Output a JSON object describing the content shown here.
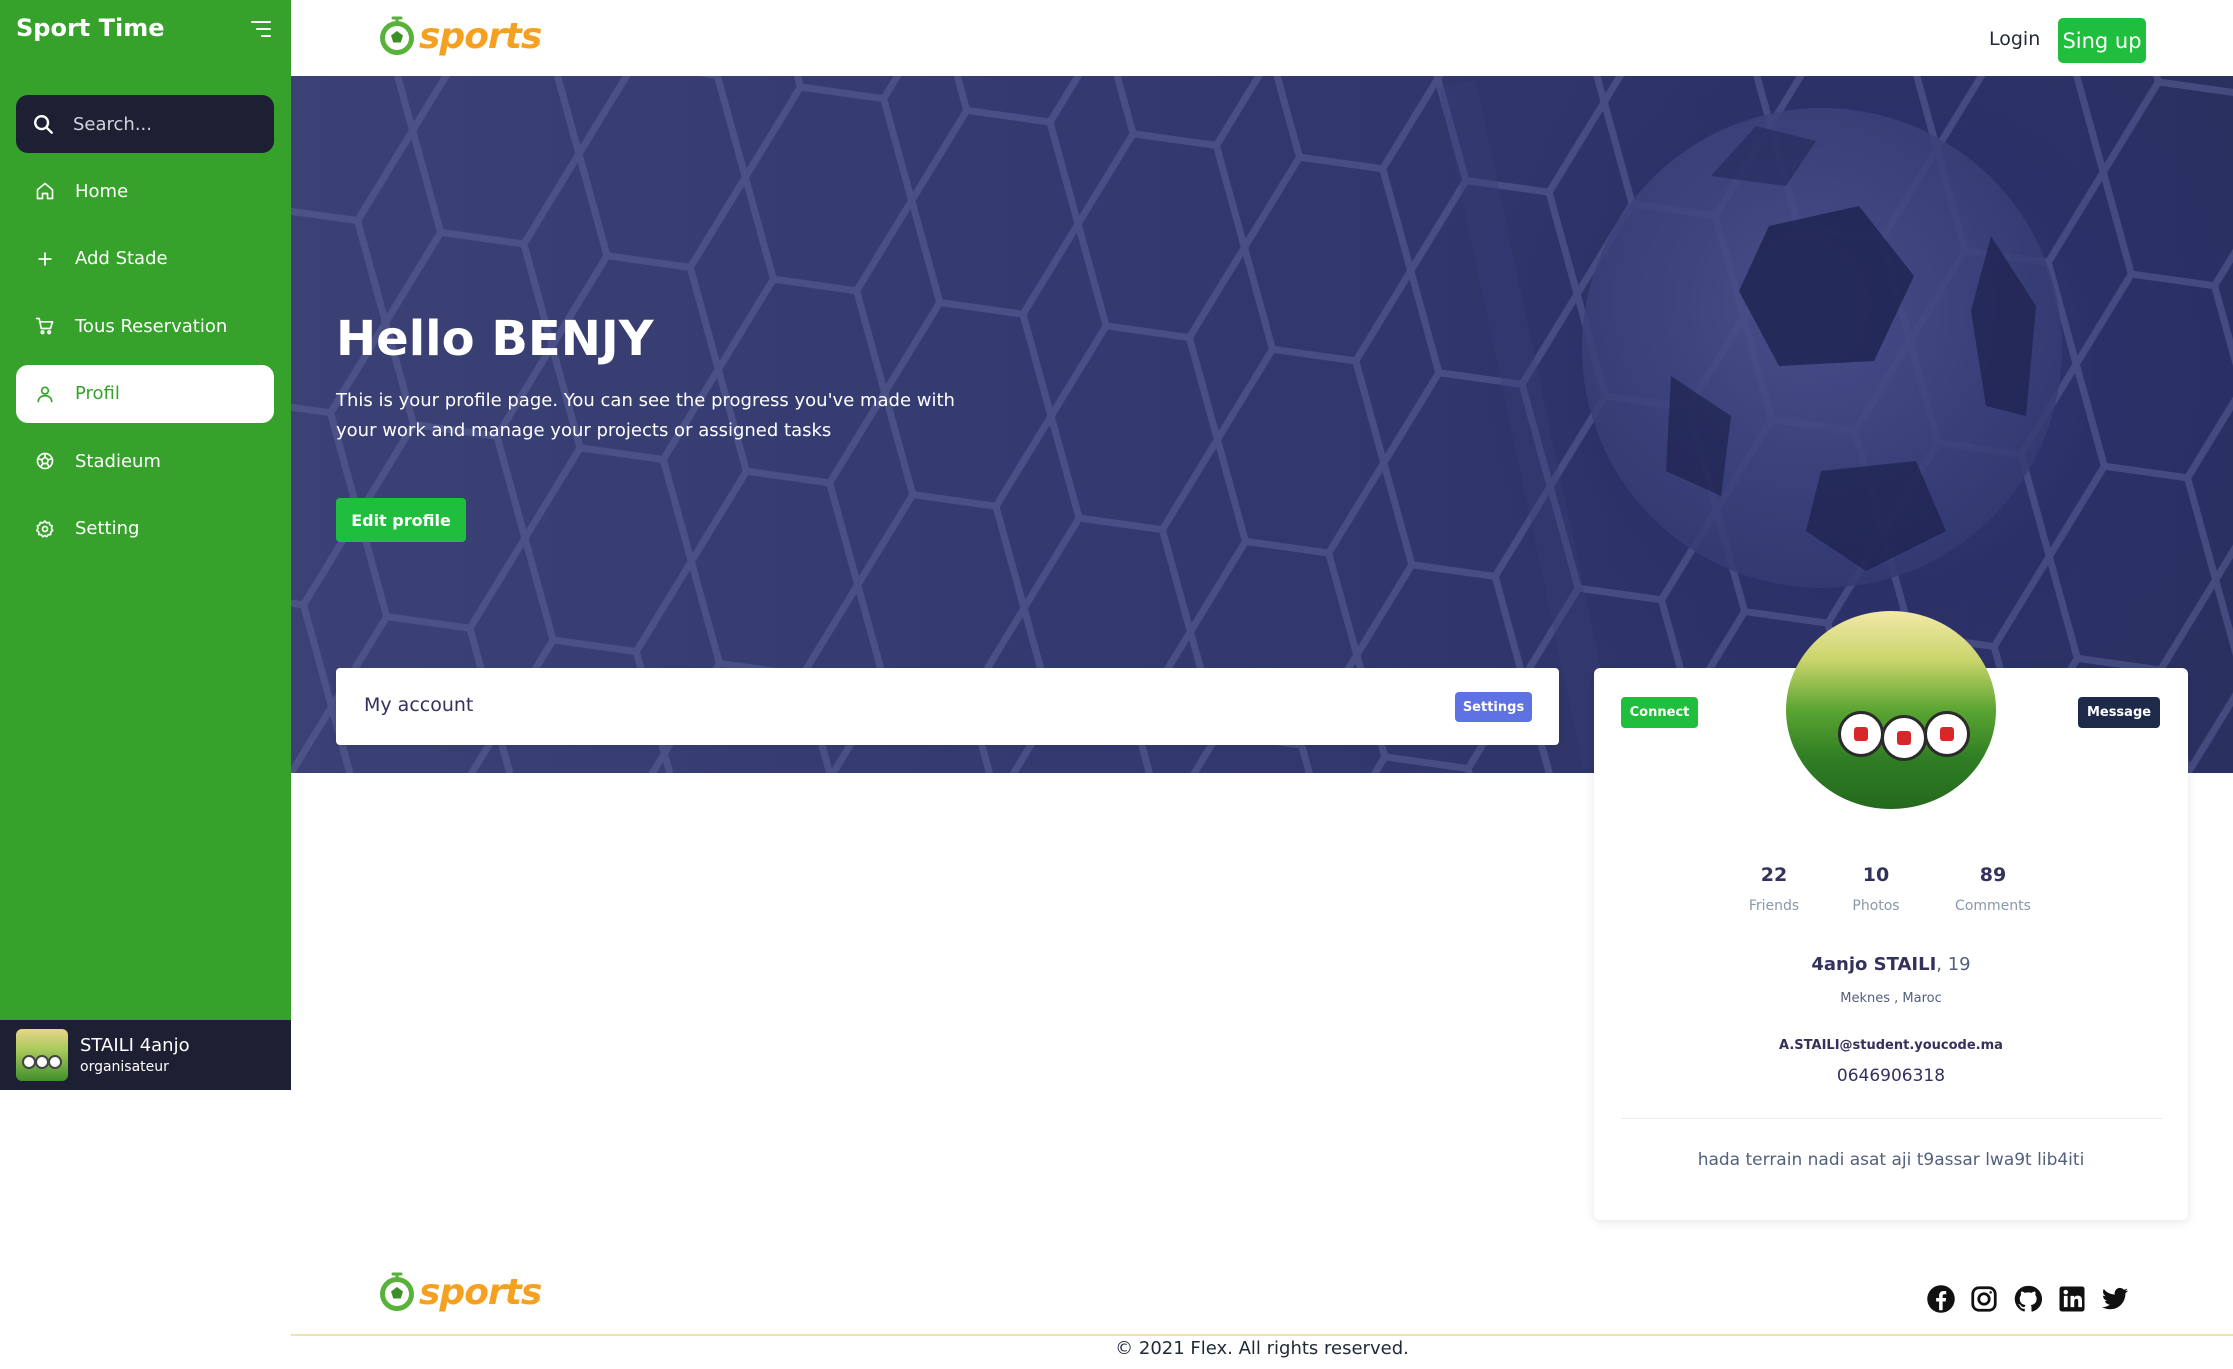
{
  "sidebar": {
    "title": "Sport Time",
    "search": {
      "placeholder": "Search..."
    },
    "items": [
      {
        "label": "Home",
        "icon": "home-icon"
      },
      {
        "label": "Add Stade",
        "icon": "plus-icon"
      },
      {
        "label": "Tous Reservation",
        "icon": "cart-icon"
      },
      {
        "label": "Profil",
        "icon": "user-icon",
        "active": true
      },
      {
        "label": "Stadieum",
        "icon": "ball-icon"
      },
      {
        "label": "Setting",
        "icon": "gear-icon"
      }
    ],
    "user": {
      "name": "STAILI 4anjo",
      "role": "organisateur"
    }
  },
  "header": {
    "logo_text": "sports",
    "login_label": "Login",
    "signup_label": "Sing up"
  },
  "hero": {
    "title": "Hello BENJY",
    "description": "This is your profile page. You can see the progress you've made with your work and manage your projects or assigned tasks",
    "button_label": "Edit profile"
  },
  "account": {
    "title": "My account",
    "settings_label": "Settings"
  },
  "profile": {
    "connect_label": "Connect",
    "message_label": "Message",
    "stats": [
      {
        "value": "22",
        "label": "Friends"
      },
      {
        "value": "10",
        "label": "Photos"
      },
      {
        "value": "89",
        "label": "Comments"
      }
    ],
    "name": "4anjo STAILI",
    "age": ", 19",
    "location": "Meknes , Maroc",
    "email": "A.STAILI@student.youcode.ma",
    "phone": "0646906318",
    "bio": "hada terrain nadi asat aji t9assar lwa9t lib4iti"
  },
  "footer": {
    "logo_text": "sports",
    "social": [
      "facebook-icon",
      "instagram-icon",
      "github-icon",
      "linkedin-icon",
      "twitter-icon"
    ],
    "copyright": "© 2021 Flex. All rights reserved."
  },
  "colors": {
    "sidebar_bg": "#37a22b",
    "dark": "#1d1f33",
    "accent_green": "#1fbe3c",
    "logo_orange": "#f4a121",
    "settings_blue": "#5e72e4",
    "hero_bg": "#333a70"
  }
}
